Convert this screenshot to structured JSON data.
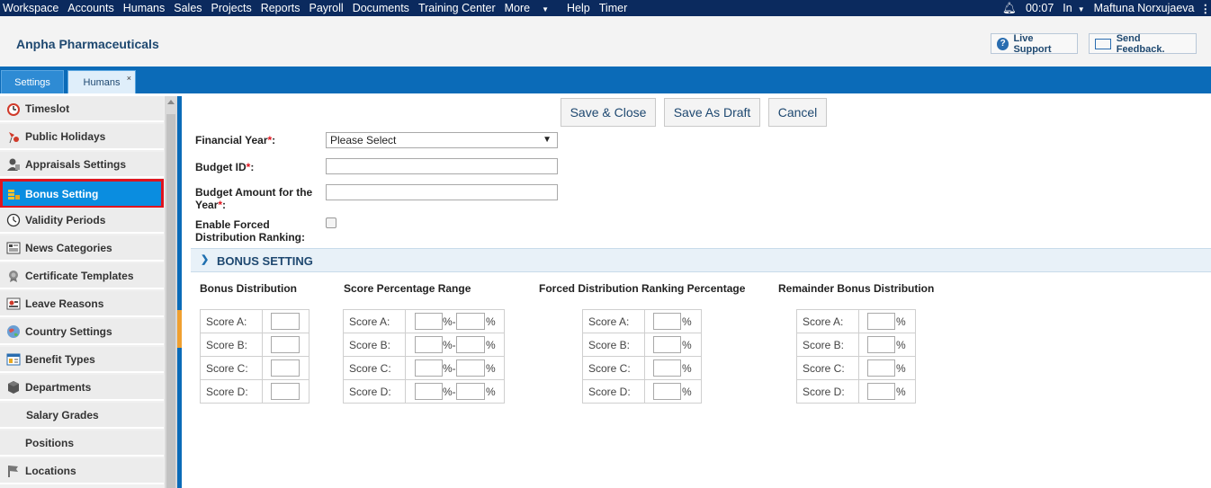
{
  "topnav": {
    "items": [
      "Workspace",
      "Accounts",
      "Humans",
      "Sales",
      "Projects",
      "Reports",
      "Payroll",
      "Documents",
      "Training Center",
      "More",
      "Help",
      "Timer"
    ],
    "time": "00:07",
    "status": "In",
    "user": "Maftuna Norxujaeva"
  },
  "header": {
    "company": "Anpha Pharmaceuticals",
    "live_support": "Live Support",
    "send_feedback": "Send Feedback."
  },
  "tabs": [
    {
      "label": "Settings",
      "active": false
    },
    {
      "label": "Humans",
      "active": true,
      "close": "×"
    }
  ],
  "sidebar": {
    "items": [
      {
        "label": "Timeslot",
        "icon": "clock-alarm-icon"
      },
      {
        "label": "Public Holidays",
        "icon": "holiday-icon"
      },
      {
        "label": "Appraisals Settings",
        "icon": "appraisal-icon"
      },
      {
        "label": "Bonus Setting",
        "icon": "coins-icon",
        "active": true
      },
      {
        "label": "Validity Periods",
        "icon": "clock-icon"
      },
      {
        "label": "News Categories",
        "icon": "news-icon"
      },
      {
        "label": "Certificate Templates",
        "icon": "certificate-icon"
      },
      {
        "label": "Leave Reasons",
        "icon": "leave-icon"
      },
      {
        "label": "Country Settings",
        "icon": "globe-icon"
      },
      {
        "label": "Benefit Types",
        "icon": "benefit-icon"
      },
      {
        "label": "Departments",
        "icon": "cube-icon"
      },
      {
        "label": "Salary Grades",
        "icon": ""
      },
      {
        "label": "Positions",
        "icon": ""
      },
      {
        "label": "Locations",
        "icon": "flag-icon"
      }
    ]
  },
  "actions": {
    "save_close": "Save & Close",
    "save_draft": "Save As Draft",
    "cancel": "Cancel"
  },
  "form": {
    "financial_year_label": "Financial Year",
    "financial_year_value": "Please Select",
    "budget_id_label": "Budget ID",
    "budget_amount_label_1": "Budget Amount for the",
    "budget_amount_label_2": "Year",
    "forced_label_1": "Enable Forced",
    "forced_label_2": "Distribution Ranking:",
    "required": "*",
    "colon": ":"
  },
  "bonus": {
    "section_title": "BONUS SETTING",
    "columns": {
      "distribution": "Bonus Distribution",
      "score_range": "Score Percentage Range",
      "forced": "Forced Distribution Ranking Percentage",
      "remainder": "Remainder Bonus Distribution"
    },
    "scores": [
      "Score A:",
      "Score B:",
      "Score C:",
      "Score D:"
    ],
    "percent": "%",
    "range_sep": "%-"
  }
}
